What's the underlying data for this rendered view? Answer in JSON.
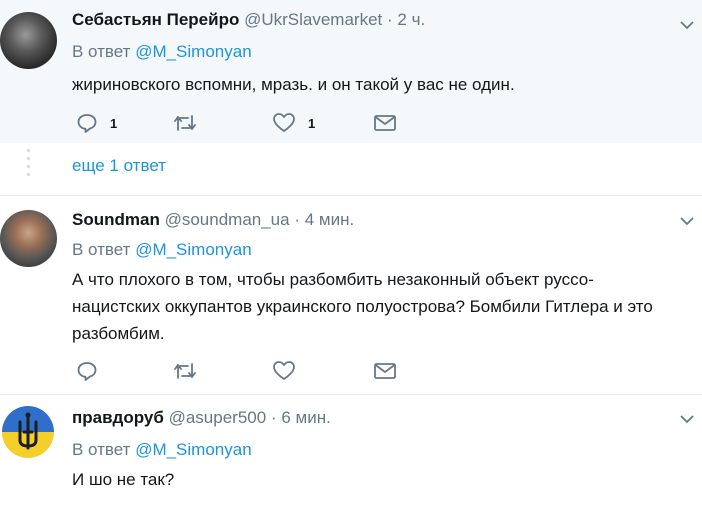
{
  "tweets": [
    {
      "name": "Себастьян Перейро",
      "handle": "@UkrSlavemarket",
      "dot": "·",
      "time": "2 ч.",
      "reply_prefix": "В ответ",
      "reply_to": "@M_Simonyan",
      "text": "жириновского вспомни, мразь. и он такой у вас не один.",
      "reply_count": "1",
      "like_count": "1"
    },
    {
      "name": "Soundman",
      "handle": "@soundman_ua",
      "dot": "·",
      "time": "4 мин.",
      "reply_prefix": "В ответ",
      "reply_to": "@M_Simonyan",
      "text_lines": [
        "А что плохого в том, чтобы разбомбить незаконный объект руссо-",
        "нацистских оккупантов украинского полуострова? Бомбили Гитлера и это",
        "разбомбим."
      ]
    },
    {
      "name": "правдоруб",
      "handle": "@asuper500",
      "dot": "·",
      "time": "6 мин.",
      "reply_prefix": "В ответ",
      "reply_to": "@M_Simonyan",
      "text": "И шо не так?"
    }
  ],
  "more_replies": "еще 1 ответ",
  "icons": {
    "reply": "reply-icon",
    "retweet": "retweet-icon",
    "like": "heart-icon",
    "dm": "envelope-icon",
    "caret": "chevron-down-icon"
  },
  "colors": {
    "link": "#1b95e0",
    "muted": "#657786",
    "text": "#14171a",
    "highlight_bg": "#f5f8fa"
  }
}
